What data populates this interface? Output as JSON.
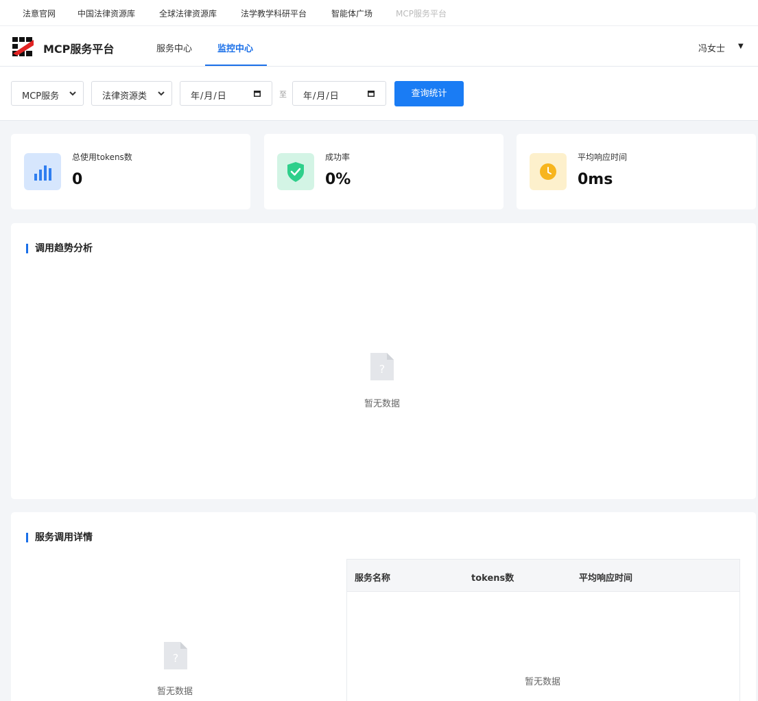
{
  "topnav": {
    "items": [
      "法意官网",
      "中国法律资源库",
      "全球法律资源库",
      "法学教学科研平台",
      "智能体广场",
      "MCP服务平台"
    ]
  },
  "header": {
    "brand": "MCP服务平台",
    "tabs": [
      {
        "label": "服务中心",
        "active": false
      },
      {
        "label": "监控中心",
        "active": true
      }
    ],
    "user": "冯女士",
    "user_caret": "▼"
  },
  "filters": {
    "service_type": "MCP服务",
    "category": "法律资源类",
    "start_date": "年/月/日",
    "end_date": "年/月/日",
    "separator": "至",
    "query_button": "查询统计"
  },
  "stats": [
    {
      "label": "总使用tokens数",
      "value": "0",
      "icon": "bar-chart-icon",
      "color": "#2f7ef0"
    },
    {
      "label": "成功率",
      "value": "0%",
      "icon": "shield-check-icon",
      "color": "#2fcf8b"
    },
    {
      "label": "平均响应时间",
      "value": "0ms",
      "icon": "clock-icon",
      "color": "#f7b51e"
    }
  ],
  "trend": {
    "title": "调用趋势分析",
    "empty_text": "暂无数据"
  },
  "details": {
    "title": "服务调用详情",
    "chart_empty_text": "暂无数据",
    "table": {
      "columns": [
        "服务名称",
        "tokens数",
        "平均响应时间"
      ],
      "empty_text": "暂无数据"
    }
  },
  "colors": {
    "accent": "#1a6fe8",
    "primary_button": "#1a7cf4",
    "logo_red": "#e12323"
  }
}
